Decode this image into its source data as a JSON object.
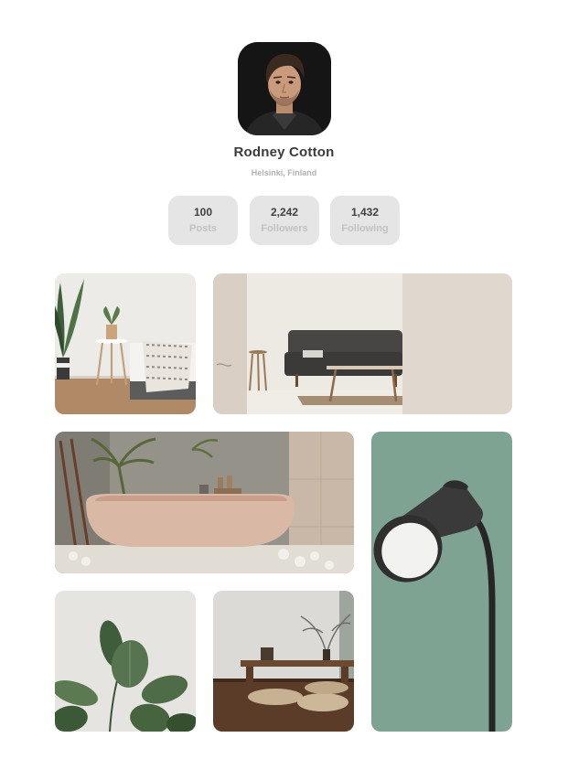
{
  "profile": {
    "name": "Rodney Cotton",
    "location": "Helsinki, Finland"
  },
  "stats": [
    {
      "value": "100",
      "label": "Posts"
    },
    {
      "value": "2,242",
      "label": "Followers"
    },
    {
      "value": "1,432",
      "label": "Following"
    }
  ],
  "gallery": [
    {
      "subject": "bedroom-with-plant"
    },
    {
      "subject": "living-room-sofa"
    },
    {
      "subject": "bathtub"
    },
    {
      "subject": "floor-lamp"
    },
    {
      "subject": "plant-leaves"
    },
    {
      "subject": "low-table-room"
    }
  ],
  "colors": {
    "stat_background": "#e5e5e5",
    "stat_label": "#c2c2c2",
    "lamp_wall": "#7fa393",
    "page_background": "#ffffff"
  }
}
